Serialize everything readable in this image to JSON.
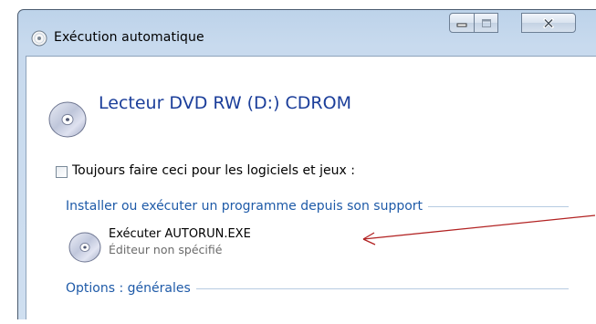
{
  "window": {
    "title": "Exécution automatique",
    "controls": {
      "minimize": "minimize",
      "maximize": "maximize",
      "close": "close"
    }
  },
  "drive": {
    "title": "Lecteur DVD RW (D:) CDROM",
    "icon": "dvd-disc-icon"
  },
  "always_checkbox": {
    "checked": false,
    "label": "Toujours faire ceci pour les logiciels et jeux :"
  },
  "sections": [
    {
      "heading": "Installer ou exécuter un programme depuis son support",
      "items": [
        {
          "title": "Exécuter AUTORUN.EXE",
          "subtitle": "Éditeur non spécifié",
          "icon": "disc-icon"
        }
      ]
    },
    {
      "heading": "Options : générales"
    }
  ],
  "annotation": {
    "type": "arrow",
    "color": "#b22222"
  },
  "colors": {
    "heading": "#1e5aa8",
    "drive_title": "#1b3e9a",
    "titlebar": "#c8daee"
  }
}
